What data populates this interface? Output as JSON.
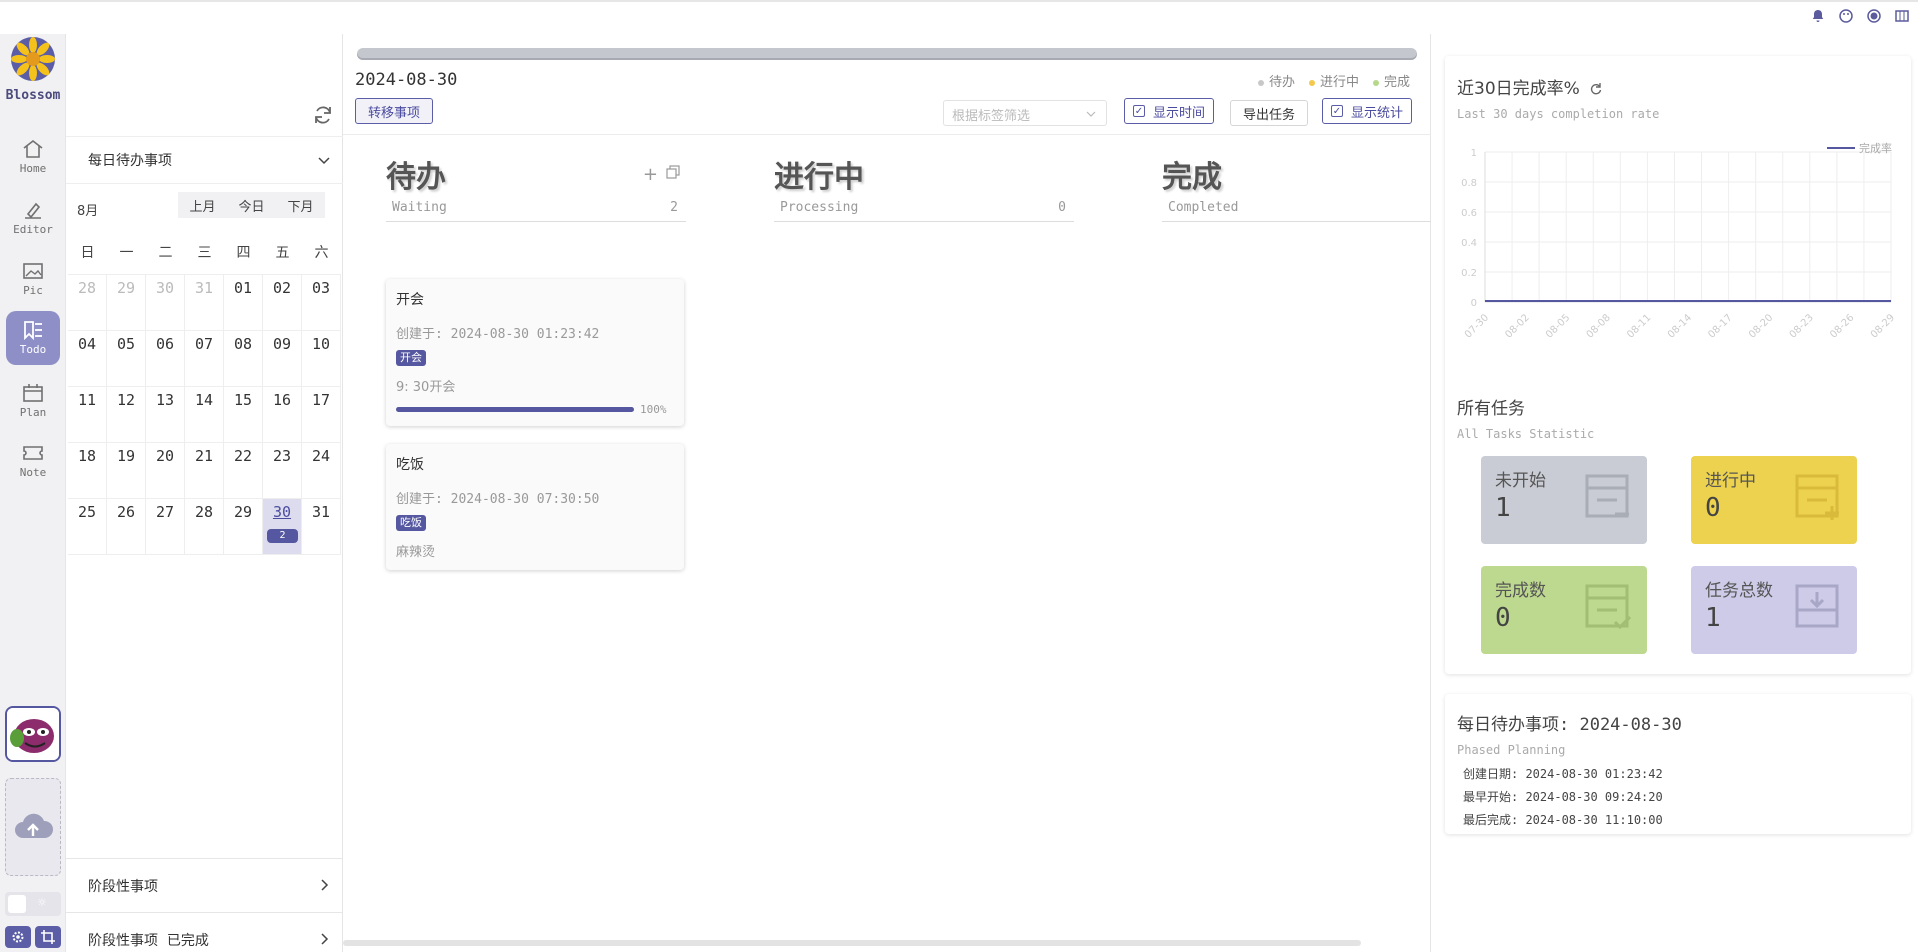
{
  "app": {
    "brand": "Blossom"
  },
  "nav": [
    {
      "label": "Home",
      "icon": "home-icon"
    },
    {
      "label": "Editor",
      "icon": "editor-icon"
    },
    {
      "label": "Pic",
      "icon": "picture-icon"
    },
    {
      "label": "Todo",
      "icon": "todo-icon",
      "active": true
    },
    {
      "label": "Plan",
      "icon": "calendar-icon"
    },
    {
      "label": "Note",
      "icon": "ticket-icon"
    }
  ],
  "sidebar": {
    "daily_title": "每日待办事项",
    "month": "8月",
    "prev": "上月",
    "today": "今日",
    "next": "下月",
    "weekdays": [
      "日",
      "一",
      "二",
      "三",
      "四",
      "五",
      "六"
    ],
    "days": [
      [
        "28",
        "29",
        "30",
        "31",
        "01",
        "02",
        "03"
      ],
      [
        "04",
        "05",
        "06",
        "07",
        "08",
        "09",
        "10"
      ],
      [
        "11",
        "12",
        "13",
        "14",
        "15",
        "16",
        "17"
      ],
      [
        "18",
        "19",
        "20",
        "21",
        "22",
        "23",
        "24"
      ],
      [
        "25",
        "26",
        "27",
        "28",
        "29",
        "30",
        "31"
      ]
    ],
    "today_badge": "2",
    "phased": "阶段性事项",
    "phased_done": "阶段性事项  已完成"
  },
  "board": {
    "date": "2024-08-30",
    "legend": [
      {
        "label": "待办",
        "color": "#c8c8c8"
      },
      {
        "label": "进行中",
        "color": "#f2c94c"
      },
      {
        "label": "完成",
        "color": "#b5d88a"
      }
    ],
    "transfer": "转移事项",
    "tag_filter_placeholder": "根据标签筛选",
    "show_time": "显示时间",
    "export": "导出任务",
    "show_stats": "显示统计",
    "columns": [
      {
        "title": "待办",
        "sub": "Waiting",
        "count": "2"
      },
      {
        "title": "进行中",
        "sub": "Processing",
        "count": "0"
      },
      {
        "title": "完成",
        "sub": "Completed",
        "count": ""
      }
    ],
    "cards": [
      {
        "title": "开会",
        "created": "创建于: 2024-08-30 01:23:42",
        "tag": "开会",
        "memo": "9: 30开会",
        "progress": 100,
        "progress_text": "100%"
      },
      {
        "title": "吃饭",
        "created": "创建于: 2024-08-30 07:30:50",
        "tag": "吃饭",
        "memo": "麻辣烫"
      }
    ]
  },
  "stats": {
    "rate_title": "近30日完成率%",
    "rate_sub": "Last 30 days completion rate",
    "all_title": "所有任务",
    "all_sub": "All Tasks Statistic",
    "tiles": [
      {
        "label": "未开始",
        "value": "1",
        "color": "#c9ccd4"
      },
      {
        "label": "进行中",
        "value": "0",
        "color": "#ecd24e"
      },
      {
        "label": "完成数",
        "value": "0",
        "color": "#bdd88f"
      },
      {
        "label": "任务总数",
        "value": "1",
        "color": "#cdcbe8"
      }
    ],
    "info_title": "每日待办事项: 2024-08-30",
    "info_sub": "Phased Planning",
    "info_created": "创建日期: 2024-08-30 01:23:42",
    "info_start": "最早开始: 2024-08-30 09:24:20",
    "info_end": "最后完成: 2024-08-30 11:10:00"
  },
  "chart_data": {
    "type": "line",
    "title": "",
    "series": [
      {
        "name": "完成率",
        "values": [
          0,
          0,
          0,
          0,
          0,
          0,
          0,
          0,
          0,
          0,
          0,
          0,
          0,
          0,
          0,
          0,
          0,
          0,
          0,
          0,
          0,
          0,
          0,
          0,
          0,
          0,
          0,
          0,
          0,
          0,
          0
        ]
      }
    ],
    "x_ticks": [
      "07-30",
      "08-02",
      "08-05",
      "08-08",
      "08-11",
      "08-14",
      "08-17",
      "08-20",
      "08-23",
      "08-26",
      "08-29"
    ],
    "y_ticks": [
      "0",
      "0.2",
      "0.4",
      "0.6",
      "0.8",
      "1"
    ],
    "ylim": [
      0,
      1
    ],
    "grid": true,
    "legend": "top-right",
    "color": "#5557a0"
  }
}
